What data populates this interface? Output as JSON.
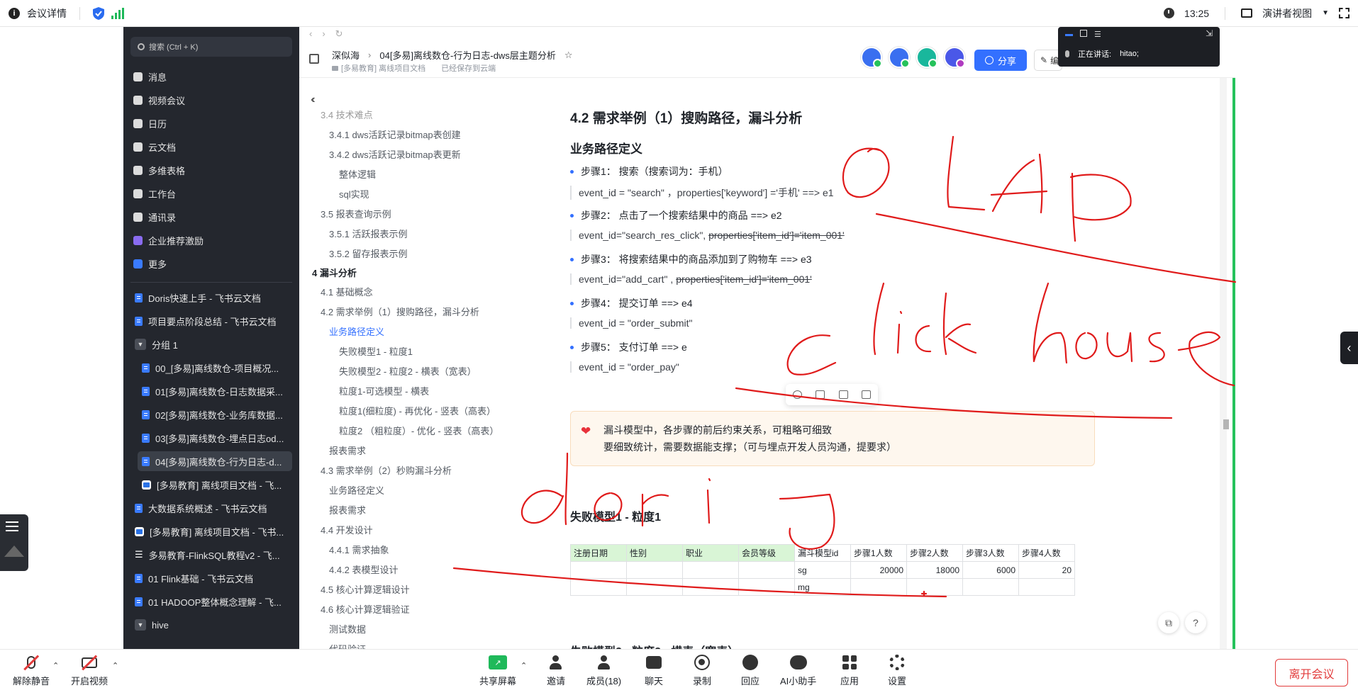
{
  "meeting": {
    "title": "会议详情",
    "time": "13:25",
    "view_label": "演讲者视图",
    "presenter_label": "正在讲话:",
    "presenter_name": "hitao;"
  },
  "sidebar": {
    "search_placeholder": "搜索 (Ctrl + K)",
    "nav": [
      {
        "label": "消息",
        "icon": "message-icon"
      },
      {
        "label": "视频会议",
        "icon": "video-icon"
      },
      {
        "label": "日历",
        "icon": "calendar-icon"
      },
      {
        "label": "云文档",
        "icon": "cloud-doc-icon"
      },
      {
        "label": "多维表格",
        "icon": "table-icon"
      },
      {
        "label": "工作台",
        "icon": "workspace-icon"
      },
      {
        "label": "通讯录",
        "icon": "contacts-icon"
      },
      {
        "label": "企业推荐激励",
        "icon": "reward-icon"
      },
      {
        "label": "更多",
        "icon": "more-icon"
      }
    ],
    "docs": [
      {
        "label": "Doris快速上手 - 飞书云文档"
      },
      {
        "label": "项目要点阶段总结 - 飞书云文档"
      },
      {
        "label": "分组 1"
      },
      {
        "label": "00_[多易]离线数仓-项目概况..."
      },
      {
        "label": "01[多易]离线数仓-日志数据采..."
      },
      {
        "label": "02[多易]离线数仓-业务库数据..."
      },
      {
        "label": "03[多易]离线数仓-埋点日志od..."
      },
      {
        "label": "04[多易]离线数仓-行为日志-d..."
      },
      {
        "label": "[多易教育] 离线项目文档 - 飞..."
      },
      {
        "label": "大数据系统概述 - 飞书云文档"
      },
      {
        "label": "[多易教育] 离线项目文档 - 飞书..."
      },
      {
        "label": "多易教育-FlinkSQL教程v2 - 飞..."
      },
      {
        "label": "01 Flink基础 - 飞书云文档"
      },
      {
        "label": "01 HADOOP整体概念理解 - 飞..."
      },
      {
        "label": "hive"
      }
    ]
  },
  "header": {
    "breadcrumb_root": "深似海",
    "doc_title": "04[多易]离线数仓-行为日志-dws层主题分析",
    "folder": "[多易教育] 离线项目文档",
    "save_status": "已经保存到云端",
    "share_label": "分享",
    "edit_label": "编"
  },
  "outline": [
    {
      "label": "3.4 技术难点",
      "level": 2
    },
    {
      "label": "3.4.1 dws活跃记录bitmap表创建",
      "level": 3
    },
    {
      "label": "3.4.2 dws活跃记录bitmap表更新",
      "level": 3
    },
    {
      "label": "整体逻辑",
      "level": 4
    },
    {
      "label": "sql实现",
      "level": 4
    },
    {
      "label": "3.5 报表查询示例",
      "level": 2
    },
    {
      "label": "3.5.1 活跃报表示例",
      "level": 3
    },
    {
      "label": "3.5.2 留存报表示例",
      "level": 3
    },
    {
      "label": "4 漏斗分析",
      "level": 1
    },
    {
      "label": "4.1 基础概念",
      "level": 2
    },
    {
      "label": "4.2 需求举例（1）搜购路径，漏斗分析",
      "level": 2
    },
    {
      "label": "业务路径定义",
      "level": 3,
      "active": true
    },
    {
      "label": "失败模型1 - 粒度1",
      "level": 4
    },
    {
      "label": "失败模型2 - 粒度2 - 横表（宽表）",
      "level": 4
    },
    {
      "label": "粒度1-可选模型 - 横表",
      "level": 4
    },
    {
      "label": "粒度1(细粒度) - 再优化 - 竖表（高表）",
      "level": 4
    },
    {
      "label": "粒度2 （粗粒度）- 优化 - 竖表（高表）",
      "level": 4
    },
    {
      "label": "报表需求",
      "level": 3
    },
    {
      "label": "4.3 需求举例（2）秒购漏斗分析",
      "level": 2
    },
    {
      "label": "业务路径定义",
      "level": 3
    },
    {
      "label": "报表需求",
      "level": 3
    },
    {
      "label": "4.4 开发设计",
      "level": 2
    },
    {
      "label": "4.4.1 需求抽象",
      "level": 3
    },
    {
      "label": "4.4.2 表模型设计",
      "level": 3
    },
    {
      "label": "4.5 核心计算逻辑设计",
      "level": 2
    },
    {
      "label": "4.6 核心计算逻辑验证",
      "level": 2
    },
    {
      "label": "测试数据",
      "level": 3
    },
    {
      "label": "代码验证",
      "level": 3
    }
  ],
  "doc": {
    "h2": "4.2 需求举例（1）搜购路径，漏斗分析",
    "h3_path": "业务路径定义",
    "step1": "步骤1： 搜索（搜索词为：手机）",
    "code1": "event_id = \"search\" ，properties['keyword'] ='手机'    ==> e1",
    "step2": "步骤2： 点击了一个搜索结果中的商品   ==> e2",
    "code2a": "event_id=\"search_res_click\", ",
    "code2b": "properties['item_id']='item_001'",
    "step3": "步骤3： 将搜索结果中的商品添加到了购物车  ==> e3",
    "code3a": "event_id=\"add_cart\" , ",
    "code3b": "properties['item_id']='item_001'",
    "step4": "步骤4： 提交订单  ==> e4",
    "code4": "event_id = \"order_submit\"",
    "step5": "步骤5： 支付订单  ==> e",
    "code5": "event_id = \"order_pay\"",
    "callout_line1": "漏斗模型中，各步骤的前后约束关系，可粗略可细致",
    "callout_line2": "要细致统计，需要数据能支撑；（可与埋点开发人员沟通，提要求）",
    "h3_model": "失败模型1 - 粒度1",
    "h3_next": "失败模型2 - 粒度2 - 横表（宽表）"
  },
  "table": {
    "headers": [
      "注册日期",
      "性别",
      "职业",
      "会员等级",
      "漏斗模型id",
      "步骤1人数",
      "步骤2人数",
      "步骤3人数",
      "步骤4人数"
    ],
    "rows": [
      [
        "",
        "",
        "",
        "",
        "sg",
        "20000",
        "18000",
        "6000",
        "20"
      ],
      [
        "",
        "",
        "",
        "",
        "mg",
        "",
        "",
        "",
        ""
      ]
    ]
  },
  "toolbar": {
    "mute": "解除静音",
    "video": "开启视频",
    "share_screen": "共享屏幕",
    "invite": "邀请",
    "members": "成员(18)",
    "chat": "聊天",
    "record": "录制",
    "react": "回应",
    "ai": "AI小助手",
    "apps": "应用",
    "settings": "设置",
    "leave": "离开会议"
  },
  "colors": {
    "accent": "#3370ff",
    "sidebar_bg": "#24272e",
    "ink": "#e01b1b",
    "leave": "#e23b3b",
    "share_green": "#1fb95a"
  }
}
